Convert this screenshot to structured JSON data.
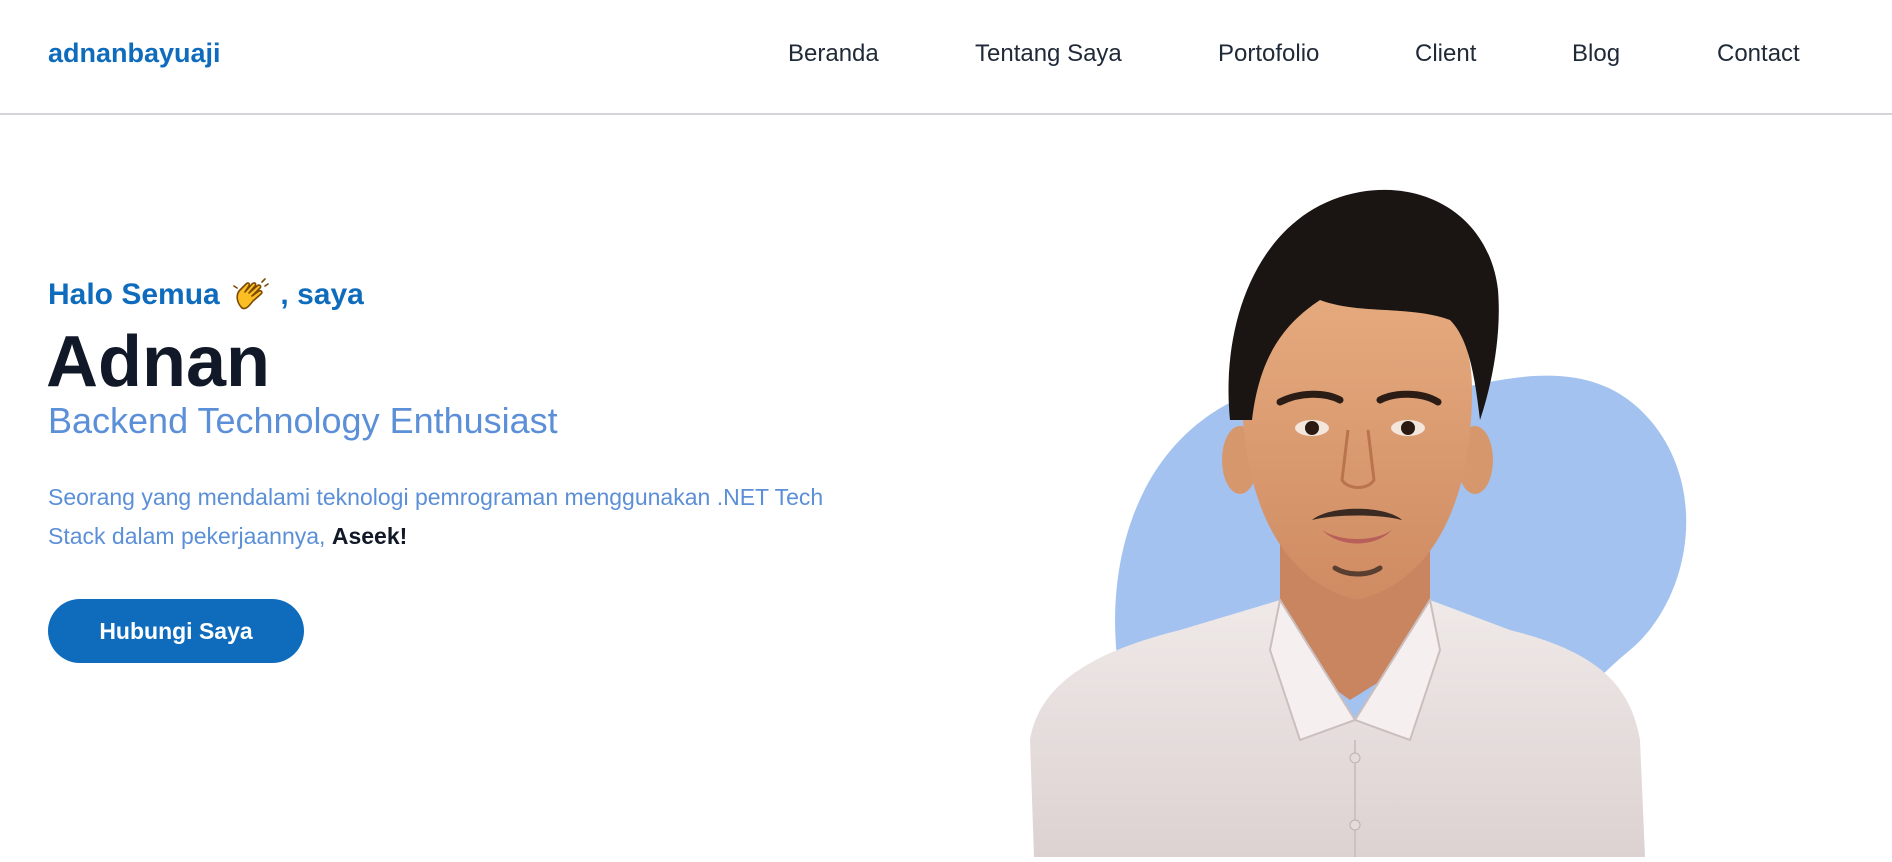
{
  "navbar": {
    "brand": "adnanbayuaji",
    "items": [
      {
        "label": "Beranda"
      },
      {
        "label": "Tentang Saya"
      },
      {
        "label": "Portofolio"
      },
      {
        "label": "Client"
      },
      {
        "label": "Blog"
      },
      {
        "label": "Contact"
      }
    ]
  },
  "hero": {
    "greeting_prefix": "Halo Semua",
    "greeting_suffix": ", saya",
    "wave_icon": "waving-hand-icon",
    "name": "Adnan",
    "role": "Backend Technology Enthusiast",
    "description_line1": "Seorang yang mendalami teknologi pemrograman menggunakan .NET Tech",
    "description_line2": "Stack dalam pekerjaannya,",
    "description_emphasis": "Aseek!",
    "cta_label": "Hubungi Saya"
  },
  "colors": {
    "brand": "#0f6cbd",
    "accent_light": "#5b8fd8",
    "blob": "#a3c2f0",
    "heading": "#111827"
  }
}
